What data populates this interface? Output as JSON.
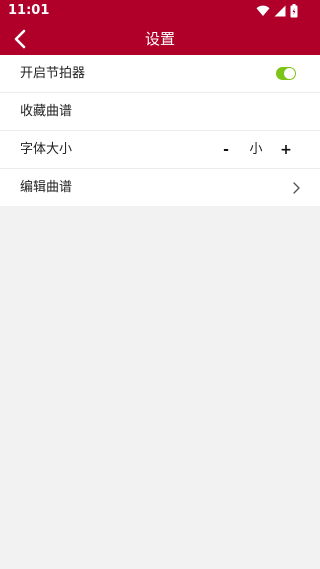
{
  "status_bar": {
    "time": "11:01",
    "icons": [
      "wifi-icon",
      "signal-icon",
      "battery-icon"
    ]
  },
  "app_bar": {
    "title": "设置",
    "back_icon": "chevron-left-icon"
  },
  "colors": {
    "primary": "#b0002a",
    "toggle_on": "#7cc418",
    "background": "#f2f2f2"
  },
  "settings": {
    "metronome": {
      "label": "开启节拍器",
      "enabled": true
    },
    "favorites": {
      "label": "收藏曲谱"
    },
    "font_size": {
      "label": "字体大小",
      "decrease": "-",
      "value": "小",
      "increase": "+"
    },
    "edit": {
      "label": "编辑曲谱",
      "icon": "chevron-right-icon"
    }
  }
}
